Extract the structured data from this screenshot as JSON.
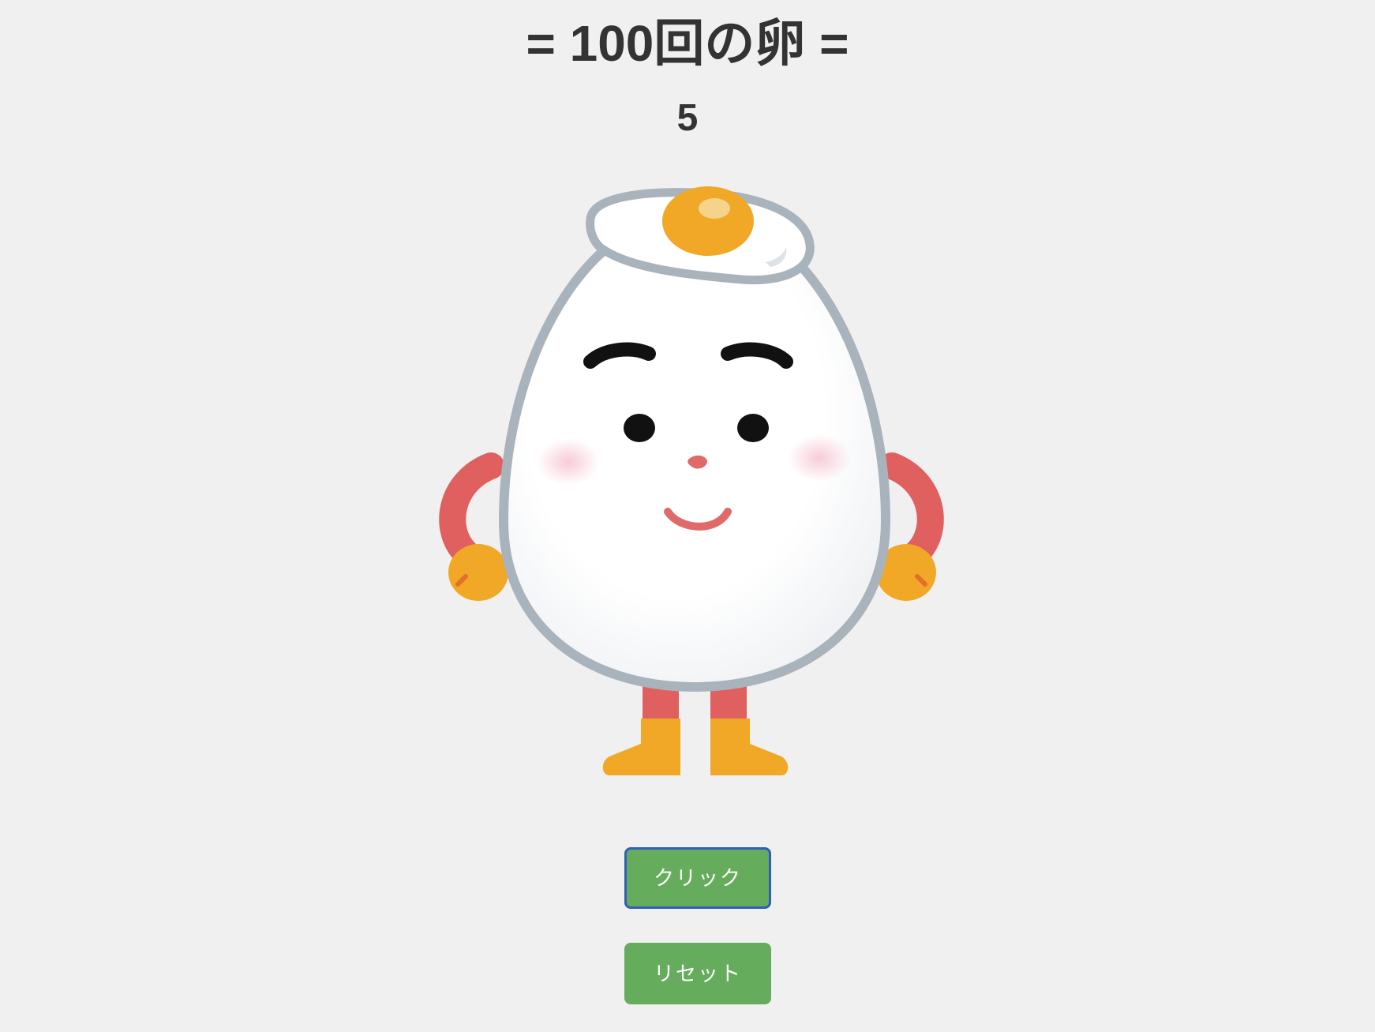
{
  "header": {
    "title": "= 100回の卵 ="
  },
  "counter": {
    "value": "5"
  },
  "controls": {
    "click_label": "クリック",
    "reset_label": "リセット"
  },
  "colors": {
    "background": "#f0f0f0",
    "text": "#333333",
    "button_bg": "#65ad5c",
    "button_text": "#ffffff",
    "focus_border": "#2f5fb8",
    "egg_outline": "#a9b3bb",
    "yolk": "#f0a826",
    "limbs": "#e06060"
  },
  "icons": {
    "character": "egg-character-icon"
  }
}
